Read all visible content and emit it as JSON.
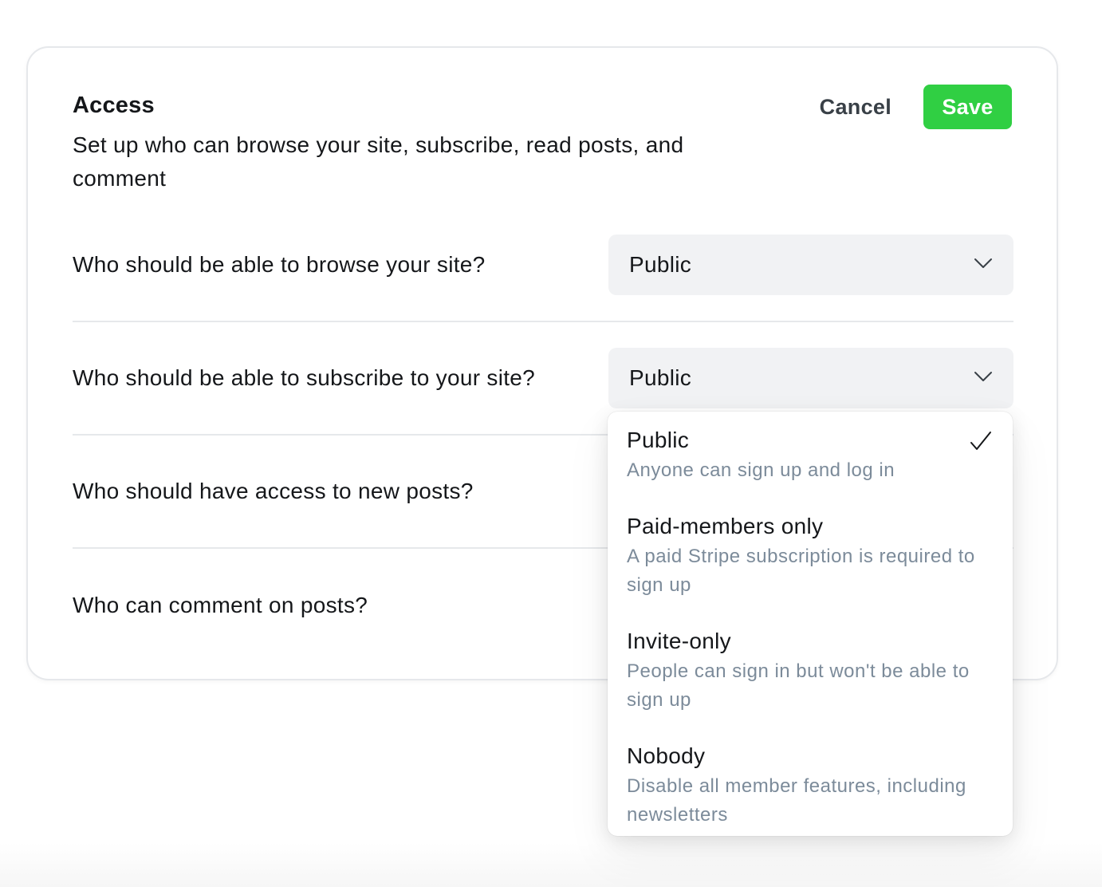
{
  "header": {
    "title": "Access",
    "subtitle": "Set up who can browse your site, subscribe, read posts, and comment",
    "cancel_label": "Cancel",
    "save_label": "Save"
  },
  "rows": [
    {
      "label": "Who should be able to browse your site?",
      "value": "Public"
    },
    {
      "label": "Who should be able to subscribe to your site?",
      "value": "Public"
    },
    {
      "label": "Who should have access to new posts?"
    },
    {
      "label": "Who can comment on posts?"
    }
  ],
  "dropdown": {
    "options": [
      {
        "title": "Public",
        "description": "Anyone can sign up and log in",
        "selected": true
      },
      {
        "title": "Paid-members only",
        "description": "A paid Stripe subscription is required to sign up",
        "selected": false
      },
      {
        "title": "Invite-only",
        "description": "People can sign in but won't be able to sign up",
        "selected": false
      },
      {
        "title": "Nobody",
        "description": "Disable all member features, including newsletters",
        "selected": false
      }
    ]
  },
  "icons": {
    "select_chevron": "chevron-down-icon",
    "selected_check": "checkmark-icon"
  },
  "colors": {
    "save_button": "#30cf43",
    "select_background": "#f1f2f4",
    "description_text": "#7c8b9a"
  }
}
